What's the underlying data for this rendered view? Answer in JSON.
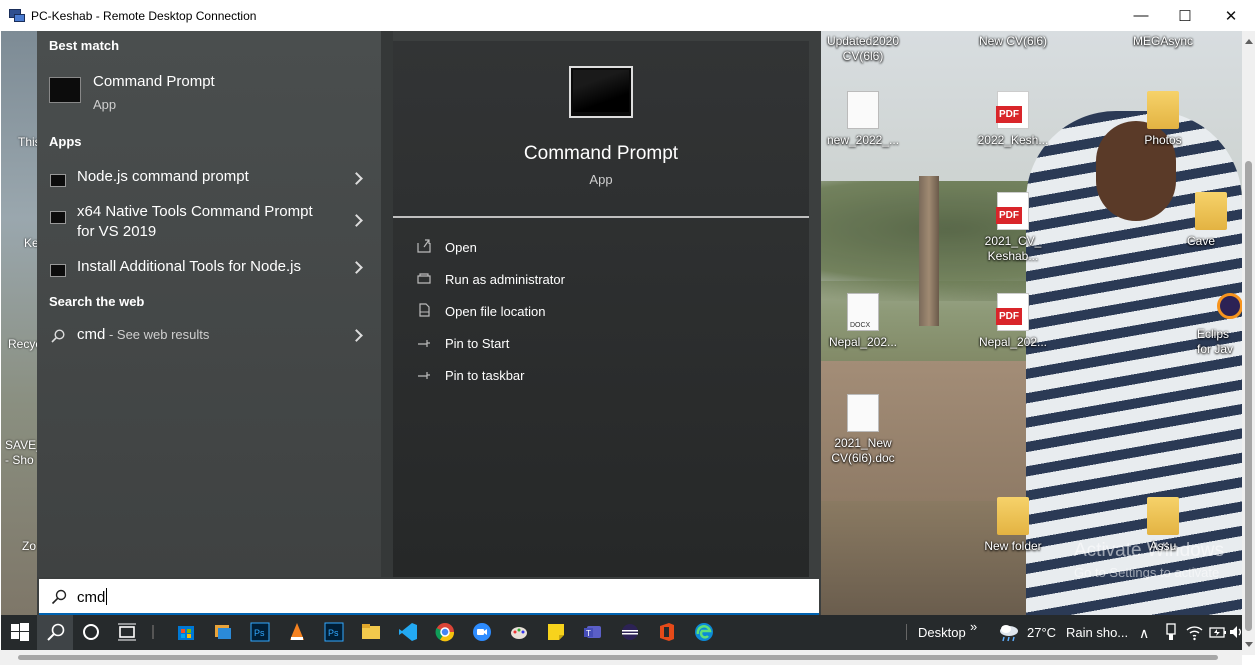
{
  "window": {
    "title": "PC-Keshab - Remote Desktop Connection",
    "minimize_glyph": "—",
    "maximize_glyph": "☐",
    "close_glyph": "✕"
  },
  "desktop_icons": [
    {
      "label": "Updated2020\nCV(6l6)",
      "type": "none"
    },
    {
      "label": "New CV(6l6)",
      "type": "none"
    },
    {
      "label": "MEGAsync",
      "type": "none"
    },
    {
      "label": "new_2022_...",
      "type": "doc"
    },
    {
      "label": "2022_Kesh...",
      "type": "pdf"
    },
    {
      "label": "Photos",
      "type": "folder"
    },
    {
      "label": "2021_CV_\nKeshab...",
      "type": "pdf"
    },
    {
      "label": "Nepal_202...",
      "type": "docx"
    },
    {
      "label": "Nepal_202...",
      "type": "pdf"
    },
    {
      "label": "2021_New\nCV(6l6).doc",
      "type": "doc"
    },
    {
      "label": "New folder",
      "type": "folder"
    },
    {
      "label": "Assu",
      "type": "folder"
    },
    {
      "label": "Cave",
      "type": "folder"
    },
    {
      "label": "Eclips\nfor Jav",
      "type": "eclipse"
    }
  ],
  "left_edge_labels": [
    "This",
    "Ke",
    "Recyc",
    "SAVE_",
    "- Sho",
    "Zo"
  ],
  "watermark": {
    "line1": "Activate Windows",
    "line2": "Go to Settings to activate"
  },
  "start_menu": {
    "best_match_header": "Best match",
    "best_match": {
      "name": "Command Prompt",
      "kind": "App"
    },
    "apps_header": "Apps",
    "apps": [
      {
        "label": "Node.js command prompt"
      },
      {
        "label": "x64 Native Tools Command Prompt\nfor VS 2019"
      },
      {
        "label": "Install Additional Tools for Node.js"
      }
    ],
    "web_header": "Search the web",
    "web_result": {
      "query": "cmd",
      "suffix": " - See web results"
    },
    "preview": {
      "title": "Command Prompt",
      "kind": "App",
      "actions": [
        "Open",
        "Run as administrator",
        "Open file location",
        "Pin to Start",
        "Pin to taskbar"
      ]
    }
  },
  "search": {
    "value": "cmd"
  },
  "taskbar": {
    "desktop_label": "Desktop",
    "more_glyph": "»",
    "weather_temp": "27°C",
    "weather_text": "Rain sho...",
    "chevron_glyph": "∧"
  },
  "colors": {
    "accent": "#0063b1",
    "pdf_red": "#d9252a",
    "start_bg": "#3c3f3f",
    "taskbar_bg": "#262a2c"
  }
}
